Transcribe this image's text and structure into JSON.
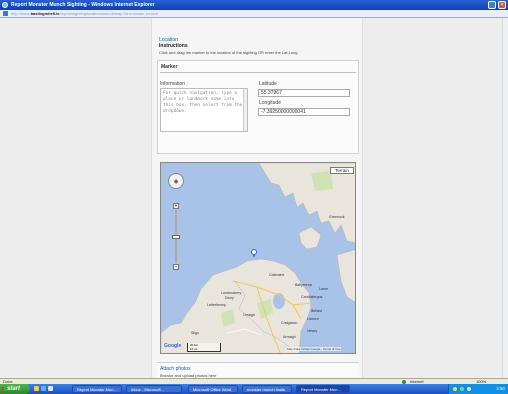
{
  "window": {
    "title": "Report Monster Munch Sighting - Windows Internet Explorer",
    "close_glyph": "✕"
  },
  "address": {
    "url_prefix": "http://www.",
    "url_domain": "baslingmhell.ie",
    "url_rest": "/report/sighting/location/submit/map?id=monster-munch"
  },
  "form": {
    "location_title": "Location",
    "instructions_heading": "Instructions",
    "instructions_text": "Click and drag the marker to the location of the sighting OR enter the Lat,Long",
    "marker_title": "Marker",
    "information_label": "Information :",
    "information_placeholder": "For quick navigation, type a place or landmark name into this box, then select from the dropdown.",
    "latitude_label": "Latitude :",
    "latitude_value": "55.37967",
    "longitude_label": "Longitude",
    "longitude_value": "-7.39250000000041"
  },
  "map": {
    "terrain_label": "Terrain",
    "pan_arrows": "◆",
    "zoom_in": "+",
    "zoom_out": "−",
    "labels": [
      {
        "text": "Greenock",
        "cls": "l1"
      },
      {
        "text": "Coleraine",
        "cls": "l2"
      },
      {
        "text": "Londonderry",
        "cls": "l3"
      },
      {
        "text": "Derry",
        "cls": "l4"
      },
      {
        "text": "Ballymena",
        "cls": "l5"
      },
      {
        "text": "Carrickfergus",
        "cls": "l6"
      },
      {
        "text": "Letterkenny",
        "cls": "l7"
      },
      {
        "text": "Belfast",
        "cls": "l8"
      },
      {
        "text": "Craigavon",
        "cls": "l9"
      },
      {
        "text": "Lisburn",
        "cls": "l10"
      },
      {
        "text": "Omagh",
        "cls": "l11"
      },
      {
        "text": "Armagh",
        "cls": "l12"
      },
      {
        "text": "Sligo",
        "cls": "l13"
      },
      {
        "text": "Newry",
        "cls": "l14"
      },
      {
        "text": "Larne",
        "cls": "l15"
      }
    ],
    "google": "Google",
    "attribution": "Map Data ©2012 Google - Terms of Use",
    "scale_top": "20 km",
    "scale_bottom": "10 mi"
  },
  "attach": {
    "title": "Attach photos",
    "subtitle": "Browse and upload photos here"
  },
  "status": {
    "done": "Done",
    "zone": "Internet",
    "zoom": "100%"
  },
  "taskbar": {
    "start": "start",
    "tasks": [
      "Report Monster Mun...",
      "Inbox - Microsoft...",
      "Microsoft Office Word",
      "monster munch finals",
      "Report Monster Mun..."
    ],
    "clock": "3:50"
  },
  "colors": {
    "accent": "#1f5ea8",
    "sea": "#a9c2e8",
    "land": "#e9e5dc"
  }
}
